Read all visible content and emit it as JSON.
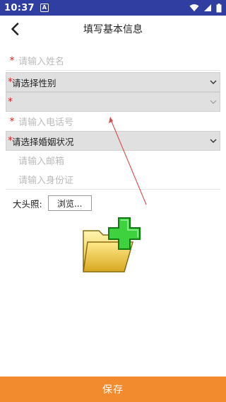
{
  "status_bar": {
    "time": "10:37",
    "badge": "A"
  },
  "header": {
    "title": "填写基本信息"
  },
  "form": {
    "name": {
      "required": "*",
      "placeholder": "请输入姓名"
    },
    "gender": {
      "required": "*",
      "value": "请选择性别"
    },
    "unknown_select": {
      "required": "*",
      "value": ""
    },
    "phone": {
      "required": "*",
      "placeholder": "请输入电话号"
    },
    "marital": {
      "required": "*",
      "value": "请选择婚姻状况"
    },
    "email": {
      "placeholder": "请输入邮箱"
    },
    "id_card": {
      "placeholder": "请输入身份证"
    },
    "avatar": {
      "label": "大头照:",
      "browse_label": "浏览..."
    }
  },
  "footer": {
    "save_label": "保存"
  },
  "colors": {
    "status_bar": "#2f3ea0",
    "save_button": "#f28a2e",
    "required": "#e02020",
    "annotation_arrow": "#d94a4a"
  },
  "icons": [
    "back-chevron-icon",
    "wifi-icon",
    "signal-icon",
    "battery-icon",
    "chevron-down-icon",
    "folder-add-icon"
  ]
}
